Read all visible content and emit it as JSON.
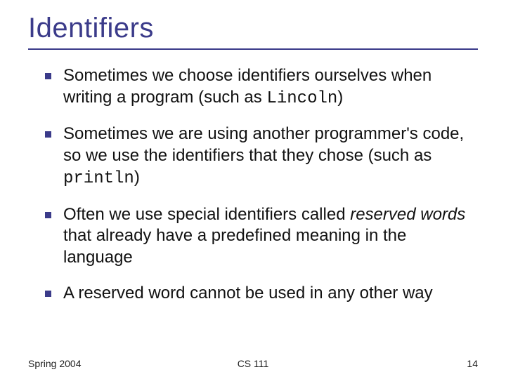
{
  "title": "Identifiers",
  "bullets": {
    "b1_a": "Sometimes we choose identifiers ourselves when writing a program (such as ",
    "b1_code": "Lincoln",
    "b1_b": ")",
    "b2_a": "Sometimes we are using another programmer's code, so we use the identifiers that they chose (such as ",
    "b2_code": "println",
    "b2_b": ")",
    "b3_a": "Often we use special identifiers called ",
    "b3_em": "reserved words",
    "b3_b": " that already have a predefined meaning in the language",
    "b4": "A reserved word cannot be used in any other way"
  },
  "footer": {
    "left": "Spring 2004",
    "center": "CS 111",
    "right": "14"
  }
}
